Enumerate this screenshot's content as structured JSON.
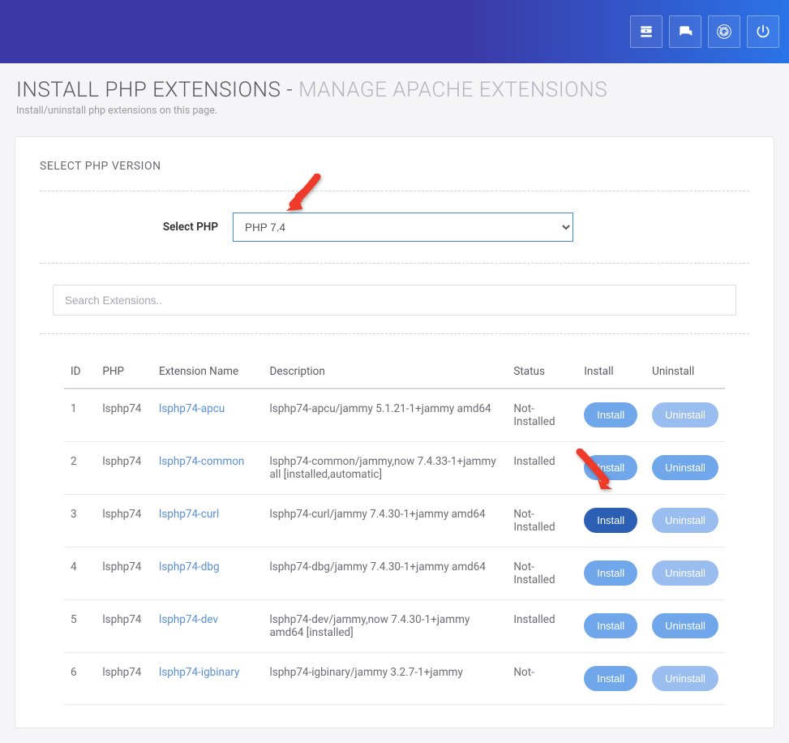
{
  "header": {
    "title_main": "INSTALL PHP EXTENSIONS -",
    "title_sub": "MANAGE APACHE EXTENSIONS",
    "subtitle": "Install/uninstall php extensions on this page."
  },
  "section": {
    "select_title": "SELECT PHP VERSION",
    "select_label": "Select PHP",
    "select_value": "PHP 7.4"
  },
  "search": {
    "placeholder": "Search Extensions.."
  },
  "table": {
    "headers": {
      "id": "ID",
      "php": "PHP",
      "ext": "Extension Name",
      "desc": "Description",
      "status": "Status",
      "install": "Install",
      "uninstall": "Uninstall"
    },
    "rows": [
      {
        "id": "1",
        "php": "lsphp74",
        "ext": "lsphp74-apcu",
        "desc": "lsphp74-apcu/jammy 5.1.21-1+jammy amd64",
        "status": "Not-Installed",
        "install_active": false,
        "uninstall_strong": false
      },
      {
        "id": "2",
        "php": "lsphp74",
        "ext": "lsphp74-common",
        "desc": "lsphp74-common/jammy,now 7.4.33-1+jammy all [installed,automatic]",
        "status": "Installed",
        "install_active": false,
        "uninstall_strong": true
      },
      {
        "id": "3",
        "php": "lsphp74",
        "ext": "lsphp74-curl",
        "desc": "lsphp74-curl/jammy 7.4.30-1+jammy amd64",
        "status": "Not-Installed",
        "install_active": true,
        "uninstall_strong": false
      },
      {
        "id": "4",
        "php": "lsphp74",
        "ext": "lsphp74-dbg",
        "desc": "lsphp74-dbg/jammy 7.4.30-1+jammy amd64",
        "status": "Not-Installed",
        "install_active": false,
        "uninstall_strong": false
      },
      {
        "id": "5",
        "php": "lsphp74",
        "ext": "lsphp74-dev",
        "desc": "lsphp74-dev/jammy,now 7.4.30-1+jammy amd64 [installed]",
        "status": "Installed",
        "install_active": false,
        "uninstall_strong": true
      },
      {
        "id": "6",
        "php": "lsphp74",
        "ext": "lsphp74-igbinary",
        "desc": "lsphp74-igbinary/jammy 3.2.7-1+jammy",
        "status": "Not-",
        "install_active": false,
        "uninstall_strong": false
      }
    ],
    "install_label": "Install",
    "uninstall_label": "Uninstall"
  }
}
